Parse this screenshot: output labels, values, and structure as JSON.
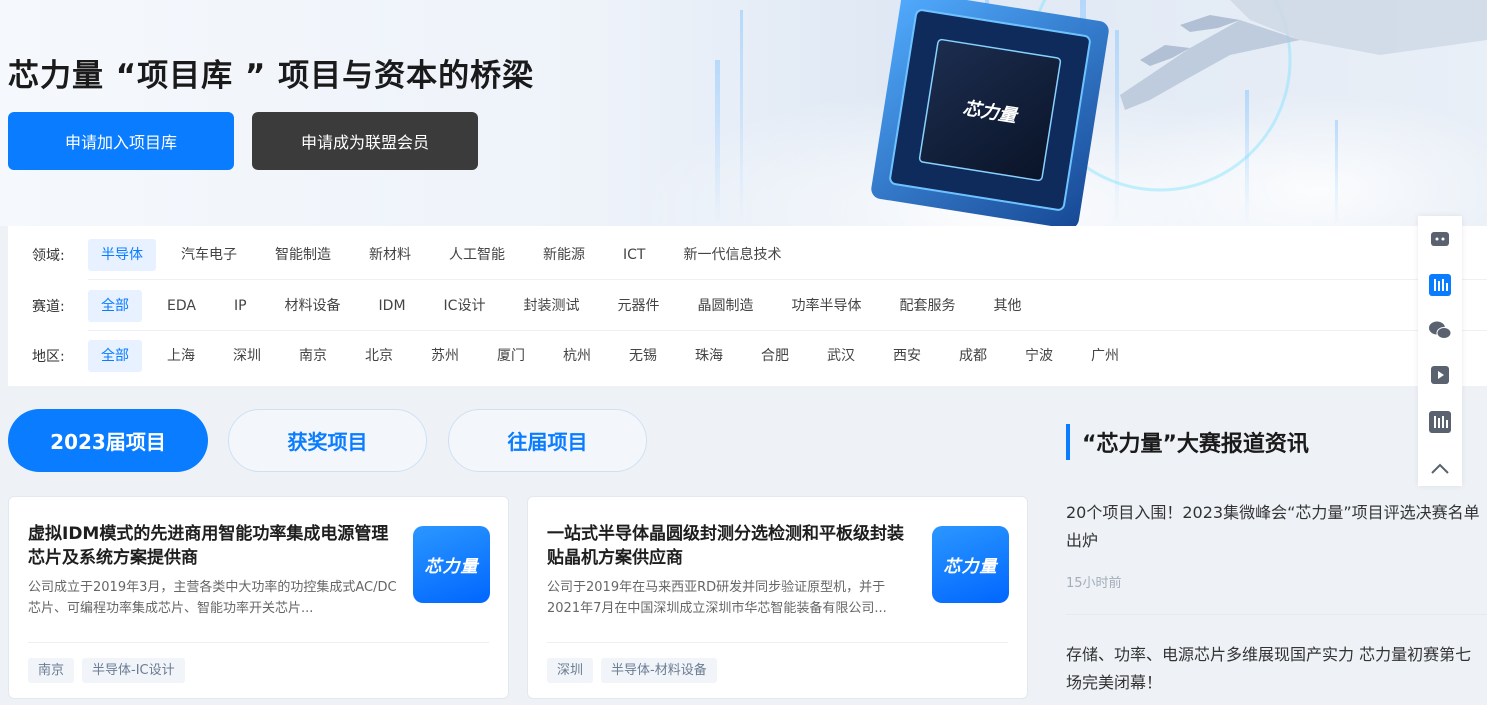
{
  "banner": {
    "title": "芯力量 “项目库 ” 项目与资本的桥梁",
    "join_button": "申请加入项目库",
    "member_button": "申请成为联盟会员",
    "chip_logo_text": "芯力量"
  },
  "filters": {
    "field": {
      "label": "领域:",
      "options": [
        "半导体",
        "汽车电子",
        "智能制造",
        "新材料",
        "人工智能",
        "新能源",
        "ICT",
        "新一代信息技术"
      ],
      "active": "半导体"
    },
    "track": {
      "label": "赛道:",
      "options": [
        "全部",
        "EDA",
        "IP",
        "材料设备",
        "IDM",
        "IC设计",
        "封装测试",
        "元器件",
        "晶圆制造",
        "功率半导体",
        "配套服务",
        "其他"
      ],
      "active": "全部"
    },
    "region": {
      "label": "地区:",
      "options": [
        "全部",
        "上海",
        "深圳",
        "南京",
        "北京",
        "苏州",
        "厦门",
        "杭州",
        "无锡",
        "珠海",
        "合肥",
        "武汉",
        "西安",
        "成都",
        "宁波",
        "广州"
      ],
      "active": "全部"
    }
  },
  "tabs": [
    "2023届项目",
    "获奖项目",
    "往届项目"
  ],
  "active_tab": "2023届项目",
  "projects": [
    {
      "title": "虚拟IDM模式的先进商用智能功率集成电源管理芯片及系统方案提供商",
      "description": "公司成立于2019年3月，主营各类中大功率的功控集成式AC/DC芯片、可编程功率集成芯片、智能功率开关芯片...",
      "logo_text": "芯力量",
      "tags": [
        "南京",
        "半导体-IC设计"
      ]
    },
    {
      "title": "一站式半导体晶圆级封测分选检测和平板级封装贴晶机方案供应商",
      "description": "公司于2019年在马来西亚RD研发并同步验证原型机，并于2021年7月在中国深圳成立深圳市华芯智能装备有限公司...",
      "logo_text": "芯力量",
      "tags": [
        "深圳",
        "半导体-材料设备"
      ]
    }
  ],
  "news": {
    "heading": "“芯力量”大赛报道资讯",
    "items": [
      {
        "title": "20个项目入围！2023集微峰会“芯力量”项目评选决赛名单出炉",
        "time": "15小时前"
      },
      {
        "title": "存储、功率、电源芯片多维展现国产实力 芯力量初赛第七场完美闭幕！"
      }
    ]
  },
  "sidebar": [
    "message-icon",
    "jiwei-logo-icon",
    "wechat-icon",
    "video-icon",
    "jiwei-app-icon",
    "back-to-top-icon"
  ],
  "colors": {
    "primary": "#0a7cff",
    "dark_button": "#3b3b3b",
    "active_chip_bg": "#e7f1ff"
  }
}
